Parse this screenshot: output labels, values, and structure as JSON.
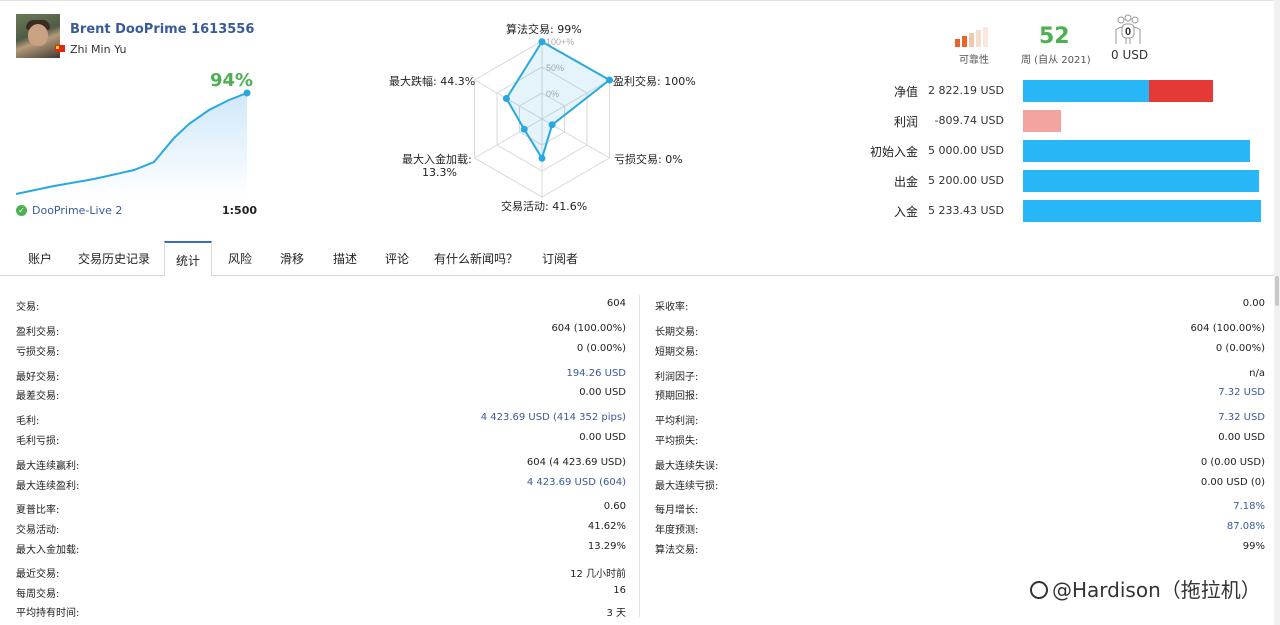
{
  "profile": {
    "account_name": "Brent DooPrime 1613556",
    "user_name": "Zhi Min Yu",
    "growth_pct": "94%",
    "broker": "DooPrime-Live 2",
    "leverage": "1:500"
  },
  "radar": {
    "labels": [
      "算法交易: 99%",
      "盈利交易: 100%",
      "亏损交易: 0%",
      "交易活动: 41.6%",
      "最大入金加载:",
      "13.3%",
      "最大跌幅: 44.3%"
    ],
    "scale": [
      "100+%",
      "50%",
      "0%"
    ],
    "values": [
      99,
      100,
      0,
      41.6,
      13.3,
      44.3
    ]
  },
  "summary": {
    "reliability_label": "可靠性",
    "weeks_value": "52",
    "weeks_label": "周 (自从 2021)",
    "subscribers_count": "0",
    "subscribers_usd": "0 USD"
  },
  "finance": [
    {
      "label": "净值",
      "value": "2 822.19 USD",
      "bars": [
        {
          "fill": 0.53,
          "color": "#29b6f6"
        },
        {
          "fill": 0.27,
          "color": "#e53935"
        }
      ]
    },
    {
      "label": "利润",
      "value": "-809.74 USD",
      "bars": [
        {
          "fill": 0.16,
          "color": "#f4a4a0"
        }
      ]
    },
    {
      "label": "初始入金",
      "value": "5 000.00 USD",
      "bars": [
        {
          "fill": 0.955,
          "color": "#29b6f6"
        }
      ]
    },
    {
      "label": "出金",
      "value": "5 200.00 USD",
      "bars": [
        {
          "fill": 0.993,
          "color": "#29b6f6"
        }
      ]
    },
    {
      "label": "入金",
      "value": "5 233.43 USD",
      "bars": [
        {
          "fill": 1.0,
          "color": "#29b6f6"
        }
      ]
    }
  ],
  "tabs": [
    "账户",
    "交易历史记录",
    "统计",
    "风险",
    "滑移",
    "描述",
    "评论",
    "有什么新闻吗？",
    "订阅者"
  ],
  "active_tab": "统计",
  "stats_left": [
    {
      "k": "交易:",
      "v": "604"
    },
    {
      "k": "盈利交易:",
      "v": "604 (100.00%)"
    },
    {
      "k": "亏损交易:",
      "v": "0 (0.00%)"
    },
    {
      "k": "最好交易:",
      "v": "194.26 USD"
    },
    {
      "k": "最差交易:",
      "v": "0.00 USD"
    },
    {
      "k": "毛利:",
      "v": "4 423.69 USD (414 352 pips)"
    },
    {
      "k": "毛利亏损:",
      "v": "0.00 USD"
    },
    {
      "k": "最大连续赢利:",
      "v": "604 (4 423.69 USD)"
    },
    {
      "k": "最大连续盈利:",
      "v": "4 423.69 USD (604)"
    },
    {
      "k": "夏普比率:",
      "v": "0.60"
    },
    {
      "k": "交易活动:",
      "v": "41.62%"
    },
    {
      "k": "最大入金加载:",
      "v": "13.29%"
    },
    {
      "k": "最近交易:",
      "v": "12 几小时前"
    },
    {
      "k": "每周交易:",
      "v": "16"
    },
    {
      "k": "平均持有时间:",
      "v": "3 天"
    }
  ],
  "stats_right": [
    {
      "k": "采收率:",
      "v": "0.00"
    },
    {
      "k": "长期交易:",
      "v": "604 (100.00%)"
    },
    {
      "k": "短期交易:",
      "v": "0 (0.00%)"
    },
    {
      "k": "利润因子:",
      "v": "n/a"
    },
    {
      "k": "预期回报:",
      "v": "7.32 USD"
    },
    {
      "k": "平均利润:",
      "v": "7.32 USD"
    },
    {
      "k": "平均损失:",
      "v": "0.00 USD"
    },
    {
      "k": "最大连续失误:",
      "v": "0 (0.00 USD)"
    },
    {
      "k": "最大连续亏损:",
      "v": "0.00 USD (0)"
    },
    {
      "k": "每月增长:",
      "v": "7.18%"
    },
    {
      "k": "年度预测:",
      "v": "87.08%"
    },
    {
      "k": "算法交易:",
      "v": "99%"
    }
  ],
  "watermark": "@Hardison（拖拉机）"
}
